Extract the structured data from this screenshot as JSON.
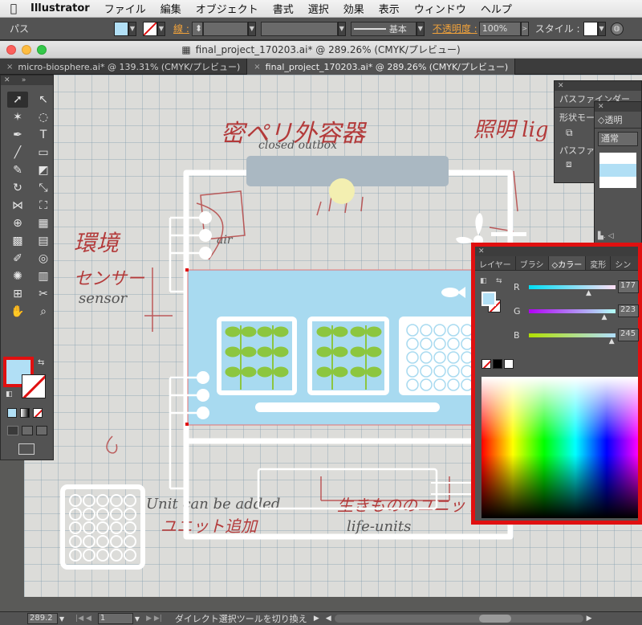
{
  "menubar": {
    "app": "Illustrator",
    "items": [
      "ファイル",
      "編集",
      "オブジェクト",
      "書式",
      "選択",
      "効果",
      "表示",
      "ウィンドウ",
      "ヘルプ"
    ]
  },
  "control": {
    "path_label": "パス",
    "stroke_label": "線 :",
    "stroke_style": "基本",
    "opacity_label": "不透明度 :",
    "opacity_value": "100%",
    "style_label": "スタイル :"
  },
  "window": {
    "title": "final_project_170203.ai* @ 289.26% (CMYK/プレビュー)"
  },
  "tabs": [
    {
      "label": "micro-biosphere.ai* @ 139.31% (CMYK/プレビュー)"
    },
    {
      "label": "final_project_170203.ai* @ 289.26% (CMYK/プレビュー)"
    }
  ],
  "sketch": {
    "closed_outbox": "closed outbox",
    "closed_jp": "密ペリ外容器",
    "lighting_jp": "照明 lig",
    "env_jp": "環境",
    "sensor_jp": "センサー",
    "sensor": "sensor",
    "air": "air",
    "unit_added": "Unit can be added",
    "tsuika": "ユニット追加",
    "life_units_jp": "生きもののユニット",
    "life_units": "life-units"
  },
  "panels": {
    "pathfinder": {
      "title": "パスファインダー",
      "shape_mode": "形状モー",
      "pathfinder": "パスファ"
    },
    "transparency": {
      "title": "透明",
      "blend_mode": "通常"
    },
    "color": {
      "tabs": [
        "レイヤー",
        "ブラシ",
        "カラー",
        "変形",
        "シン"
      ],
      "active_tab": "カラー",
      "r_label": "R",
      "r_value": "177",
      "r_frac": 0.694,
      "g_label": "G",
      "g_value": "223",
      "g_frac": 0.875,
      "b_label": "B",
      "b_value": "245",
      "b_frac": 0.961
    }
  },
  "status": {
    "zoom": "289.2",
    "page": "1",
    "tool_message": "ダイレクト選択ツールを切り換え"
  },
  "colors": {
    "fill": "#b1dff5",
    "highlight_red": "#e01010",
    "art_blue": "#a8daf0",
    "leaf_green": "#8cc63f",
    "lid_gray": "#aab8c2"
  }
}
